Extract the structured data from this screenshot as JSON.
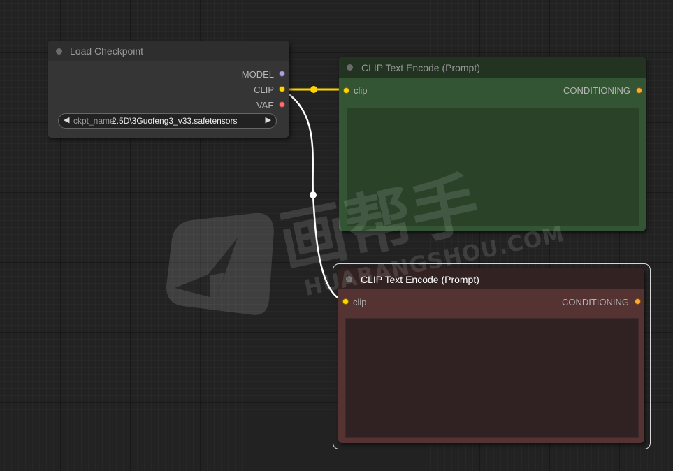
{
  "watermark": {
    "brand": "画帮手",
    "url": "HUABANGSHOU.COM"
  },
  "nodes": {
    "load_checkpoint": {
      "title": "Load Checkpoint",
      "outputs": {
        "model": {
          "label": "MODEL",
          "color": "#b39ddb"
        },
        "clip": {
          "label": "CLIP",
          "color": "#ffd500"
        },
        "vae": {
          "label": "VAE",
          "color": "#ff6e6e"
        }
      },
      "widget": {
        "name": "ckpt_name",
        "value": "2.5D\\3Guofeng3_v33.safetensors",
        "left_arrow": "◀",
        "right_arrow": "▶"
      }
    },
    "clip_text_encode_positive": {
      "title": "CLIP Text Encode (Prompt)",
      "input_label": "clip",
      "input_color": "#ffd500",
      "output_label": "CONDITIONING",
      "output_color": "#ffa931",
      "text": ""
    },
    "clip_text_encode_negative": {
      "title": "CLIP Text Encode (Prompt)",
      "input_label": "clip",
      "input_color": "#ffd500",
      "output_label": "CONDITIONING",
      "output_color": "#ffa931",
      "text": ""
    }
  },
  "links": {
    "clip_to_positive_color": "#ffd500",
    "clip_to_negative_color": "#ffffff"
  }
}
